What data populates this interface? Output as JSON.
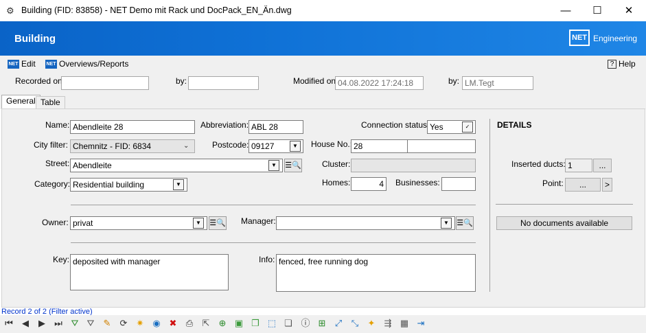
{
  "window": {
    "title": "Building (FID: 83858) - NET Demo mit Rack und DocPack_EN_Än.dwg",
    "minimize": "—",
    "maximize": "☐",
    "close": "✕"
  },
  "banner": {
    "title": "Building",
    "logo": "NET",
    "logo_text": "Engineering"
  },
  "menu": {
    "edit": "Edit",
    "overviews": "Overviews/Reports",
    "help": "Help",
    "net_icon": "NET",
    "help_icon": "?"
  },
  "record": {
    "recorded_on_label": "Recorded on:",
    "recorded_on_value": "",
    "recorded_by_label": "by:",
    "recorded_by_value": "",
    "modified_on_label": "Modified on:",
    "modified_on_value": "04.08.2022 17:24:18",
    "modified_by_label": "by:",
    "modified_by_value": "LM.Tegt"
  },
  "tabs": [
    "General",
    "Table"
  ],
  "form": {
    "name_label": "Name:",
    "name_value": "Abendleite 28",
    "abbreviation_label": "Abbreviation:",
    "abbreviation_value": "ABL 28",
    "connection_label": "Connection status:",
    "connection_value": "Yes",
    "city_label": "City filter:",
    "city_value": "Chemnitz - FID: 6834",
    "postcode_label": "Postcode:",
    "postcode_value": "09127",
    "house_label": "House No.:",
    "house_value": "28",
    "house_suffix": "",
    "street_label": "Street:",
    "street_value": "Abendleite",
    "cluster_label": "Cluster:",
    "cluster_value": "",
    "category_label": "Category:",
    "category_value": "Residential building",
    "homes_label": "Homes:",
    "homes_value": "4",
    "businesses_label": "Businesses:",
    "businesses_value": "",
    "owner_label": "Owner:",
    "owner_value": "privat",
    "manager_label": "Manager:",
    "manager_value": "",
    "key_label": "Key:",
    "key_value": "deposited with manager",
    "info_label": "Info:",
    "info_value": "fenced, free running dog"
  },
  "details": {
    "title": "DETAILS",
    "ducts_label": "Inserted ducts:",
    "ducts_value": "1",
    "ducts_btn": "...",
    "point_label": "Point:",
    "point_btn": "...",
    "point_arrow": ">",
    "no_docs": "No documents available"
  },
  "status": {
    "text": "Record 2 of 2 (Filter active)"
  },
  "toolbar_icons": [
    {
      "name": "first-record-icon",
      "glyph": "⏮",
      "color": "#333"
    },
    {
      "name": "prev-record-icon",
      "glyph": "◀",
      "color": "#333"
    },
    {
      "name": "next-record-icon",
      "glyph": "▶",
      "color": "#333"
    },
    {
      "name": "last-record-icon",
      "glyph": "⏭",
      "color": "#333"
    },
    {
      "name": "add-filter-icon",
      "glyph": "⛛",
      "color": "#2a8a2a"
    },
    {
      "name": "filter-icon",
      "glyph": "⛛",
      "color": "#555"
    },
    {
      "name": "edit-pencil-icon",
      "glyph": "✎",
      "color": "#d08000"
    },
    {
      "name": "refresh-icon",
      "glyph": "⟳",
      "color": "#333"
    },
    {
      "name": "new-icon",
      "glyph": "✷",
      "color": "#e5a000"
    },
    {
      "name": "globe-icon",
      "glyph": "◉",
      "color": "#1a6fc2"
    },
    {
      "name": "delete-icon",
      "glyph": "✖",
      "color": "#d01010"
    },
    {
      "name": "print-icon",
      "glyph": "⎙",
      "color": "#333"
    },
    {
      "name": "select-icon",
      "glyph": "⇱",
      "color": "#555"
    },
    {
      "name": "zoom-icon",
      "glyph": "⊕",
      "color": "#2a8a2a"
    },
    {
      "name": "layer-icon",
      "glyph": "▣",
      "color": "#3a9a3a"
    },
    {
      "name": "copy-layer-icon",
      "glyph": "❐",
      "color": "#3a9a3a"
    },
    {
      "name": "frame-icon",
      "glyph": "⬚",
      "color": "#1a6fc2"
    },
    {
      "name": "group-icon",
      "glyph": "❏",
      "color": "#555"
    },
    {
      "name": "info-icon",
      "glyph": "ⓘ",
      "color": "#333"
    },
    {
      "name": "table-add-icon",
      "glyph": "⊞",
      "color": "#2a8a2a"
    },
    {
      "name": "connect-icon",
      "glyph": "⤢",
      "color": "#1a6fc2"
    },
    {
      "name": "disconnect-icon",
      "glyph": "⤡",
      "color": "#1a6fc2"
    },
    {
      "name": "star-doc-icon",
      "glyph": "✦",
      "color": "#e5a000"
    },
    {
      "name": "route-icon",
      "glyph": "⇶",
      "color": "#555"
    },
    {
      "name": "grid-icon",
      "glyph": "▦",
      "color": "#555"
    },
    {
      "name": "exit-icon",
      "glyph": "⇥",
      "color": "#1a6fc2"
    }
  ]
}
